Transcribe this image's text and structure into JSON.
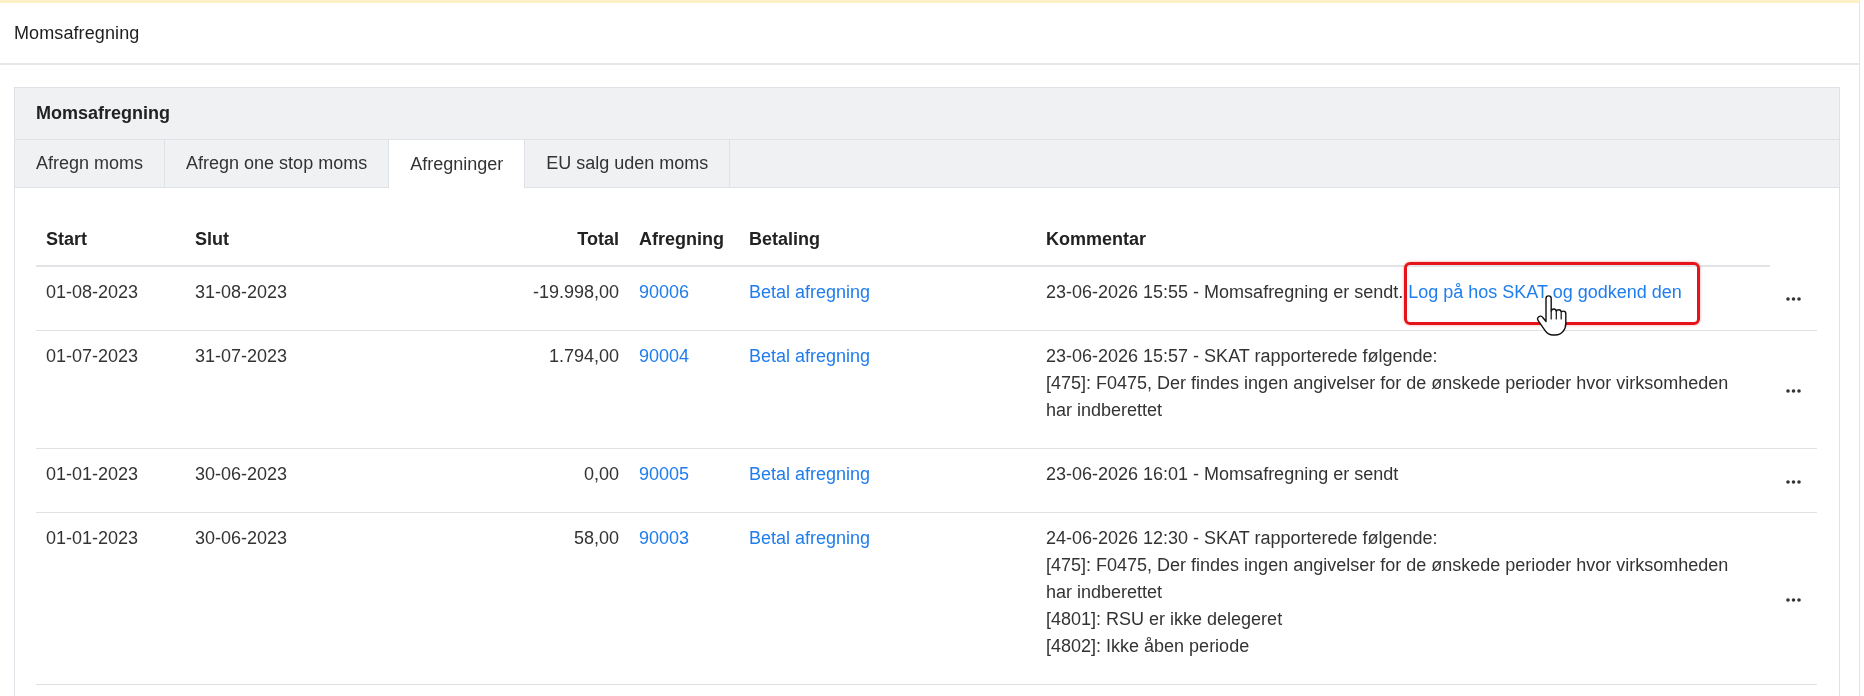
{
  "page": {
    "title": "Momsafregning"
  },
  "card": {
    "title": "Momsafregning"
  },
  "tabs": [
    {
      "label": "Afregn moms",
      "selected": false
    },
    {
      "label": "Afregn one stop moms",
      "selected": false
    },
    {
      "label": "Afregninger",
      "selected": true
    },
    {
      "label": "EU salg uden moms",
      "selected": false
    }
  ],
  "table": {
    "columns": [
      "Start",
      "Slut",
      "Total",
      "Afregning",
      "Betaling",
      "Kommentar"
    ],
    "rows": [
      {
        "start": "01-08-2023",
        "end": "31-08-2023",
        "total": "-19.998,00",
        "settlement": "90006",
        "payment": "Betal afregning",
        "comment": {
          "lines": [
            "23-06-2026 15:55 - Momsafregning er sendt."
          ],
          "link": {
            "text": "Log på hos SKAT og godkend den",
            "highlighted": true,
            "hovered": true
          }
        }
      },
      {
        "start": "01-07-2023",
        "end": "31-07-2023",
        "total": "1.794,00",
        "settlement": "90004",
        "payment": "Betal afregning",
        "comment": {
          "lines": [
            "23-06-2026 15:57 - SKAT rapporterede følgende:",
            "[475]: F0475, Der findes ingen angivelser for de ønskede perioder hvor virksomheden har indberettet"
          ]
        }
      },
      {
        "start": "01-01-2023",
        "end": "30-06-2023",
        "total": "0,00",
        "settlement": "90005",
        "payment": "Betal afregning",
        "comment": {
          "lines": [
            "23-06-2026 16:01 - Momsafregning er sendt"
          ]
        }
      },
      {
        "start": "01-01-2023",
        "end": "30-06-2023",
        "total": "58,00",
        "settlement": "90003",
        "payment": "Betal afregning",
        "comment": {
          "lines": [
            "24-06-2026 12:30 - SKAT rapporterede følgende:",
            "[475]: F0475, Der findes ingen angivelser for de ønskede perioder hvor virksomheden har indberettet",
            "[4801]: RSU er ikke delegeret",
            "[4802]: Ikke åben periode"
          ]
        }
      }
    ]
  }
}
